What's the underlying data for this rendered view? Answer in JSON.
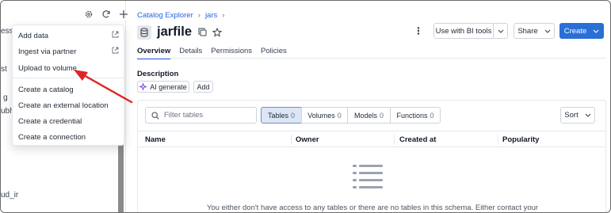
{
  "left_panel": {
    "clipped_labels": [
      "ess",
      "st",
      "g",
      "ubh",
      "ud_ir"
    ],
    "toolbar_icons": [
      "gear-icon",
      "refresh-icon",
      "plus-icon"
    ]
  },
  "dropdown": {
    "items": [
      {
        "label": "Add data",
        "external": true
      },
      {
        "label": "Ingest via partner",
        "external": true
      },
      {
        "label": "Upload to volume",
        "external": false
      },
      {
        "label": "Create a catalog",
        "external": false
      },
      {
        "label": "Create an external location",
        "external": false
      },
      {
        "label": "Create a credential",
        "external": false
      },
      {
        "label": "Create a connection",
        "external": false
      }
    ]
  },
  "annotation": {
    "color": "#e02424"
  },
  "breadcrumb": {
    "root": "Catalog Explorer",
    "schema": "jars"
  },
  "header": {
    "title": "jarfile",
    "bi_tools_label": "Use with BI tools",
    "share_label": "Share",
    "create_label": "Create"
  },
  "tabs": [
    "Overview",
    "Details",
    "Permissions",
    "Policies"
  ],
  "description": {
    "label": "Description",
    "ai_label": "AI generate",
    "add_label": "Add"
  },
  "table": {
    "filter_placeholder": "Filter tables",
    "segments": [
      {
        "label": "Tables",
        "count": "0"
      },
      {
        "label": "Volumes",
        "count": "0"
      },
      {
        "label": "Models",
        "count": "0"
      },
      {
        "label": "Functions",
        "count": "0"
      }
    ],
    "sort_label": "Sort",
    "columns": [
      "Name",
      "Owner",
      "Created at",
      "Popularity"
    ],
    "empty_text": "You either don't have access to any tables or there are no tables in this schema. Either contact your"
  },
  "colors": {
    "accent": "#2a6fd6",
    "link": "#2563eb"
  }
}
